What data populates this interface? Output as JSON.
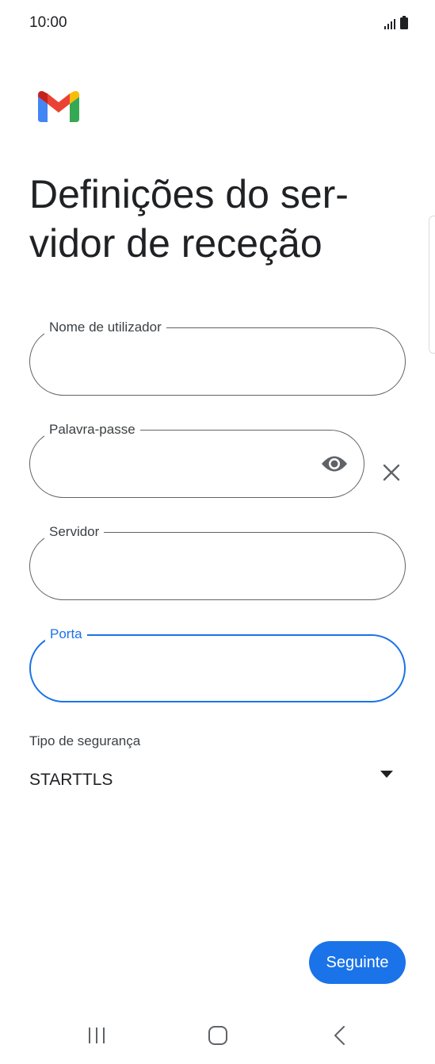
{
  "status_bar": {
    "time": "10:00",
    "icons": [
      "signal-icon",
      "battery-icon"
    ]
  },
  "header": {
    "logo": "gmail-logo",
    "title": "Definições do ser-\nvidor de receção"
  },
  "form": {
    "username": {
      "label": "Nome de utilizador",
      "value": ""
    },
    "password": {
      "label": "Palavra-passe",
      "value": "",
      "icons": [
        "eye-icon",
        "close-icon"
      ]
    },
    "server": {
      "label": "Servidor",
      "value": ""
    },
    "port": {
      "label": "Porta",
      "value": "",
      "focused": true
    },
    "security": {
      "label": "Tipo de segurança",
      "selected": "STARTTLS",
      "icon": "dropdown-arrow-icon"
    }
  },
  "actions": {
    "next_label": "Seguinte"
  },
  "nav_bar": {
    "icons": [
      "recents-icon",
      "home-icon",
      "back-icon"
    ]
  },
  "colors": {
    "accent": "#1a73e8",
    "outline": "#5f6368",
    "text": "#202124",
    "background": "#ffffff"
  }
}
